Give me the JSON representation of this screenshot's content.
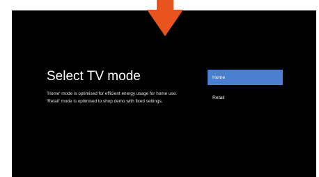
{
  "screen": {
    "title": "Select TV mode",
    "description_lines": [
      "'Home' mode is optimised for efficient energy usage for home use.",
      "'Retail' mode is optimised to shop demo with fixed settings."
    ]
  },
  "options": [
    {
      "label": "Home",
      "selected": true
    },
    {
      "label": "Retail",
      "selected": false
    }
  ],
  "indicator": {
    "icon": "down-arrow-icon",
    "color": "#e8531e"
  },
  "colors": {
    "screen_background": "#000000",
    "selected_option": "#4a7fcf",
    "text": "#ffffff"
  }
}
